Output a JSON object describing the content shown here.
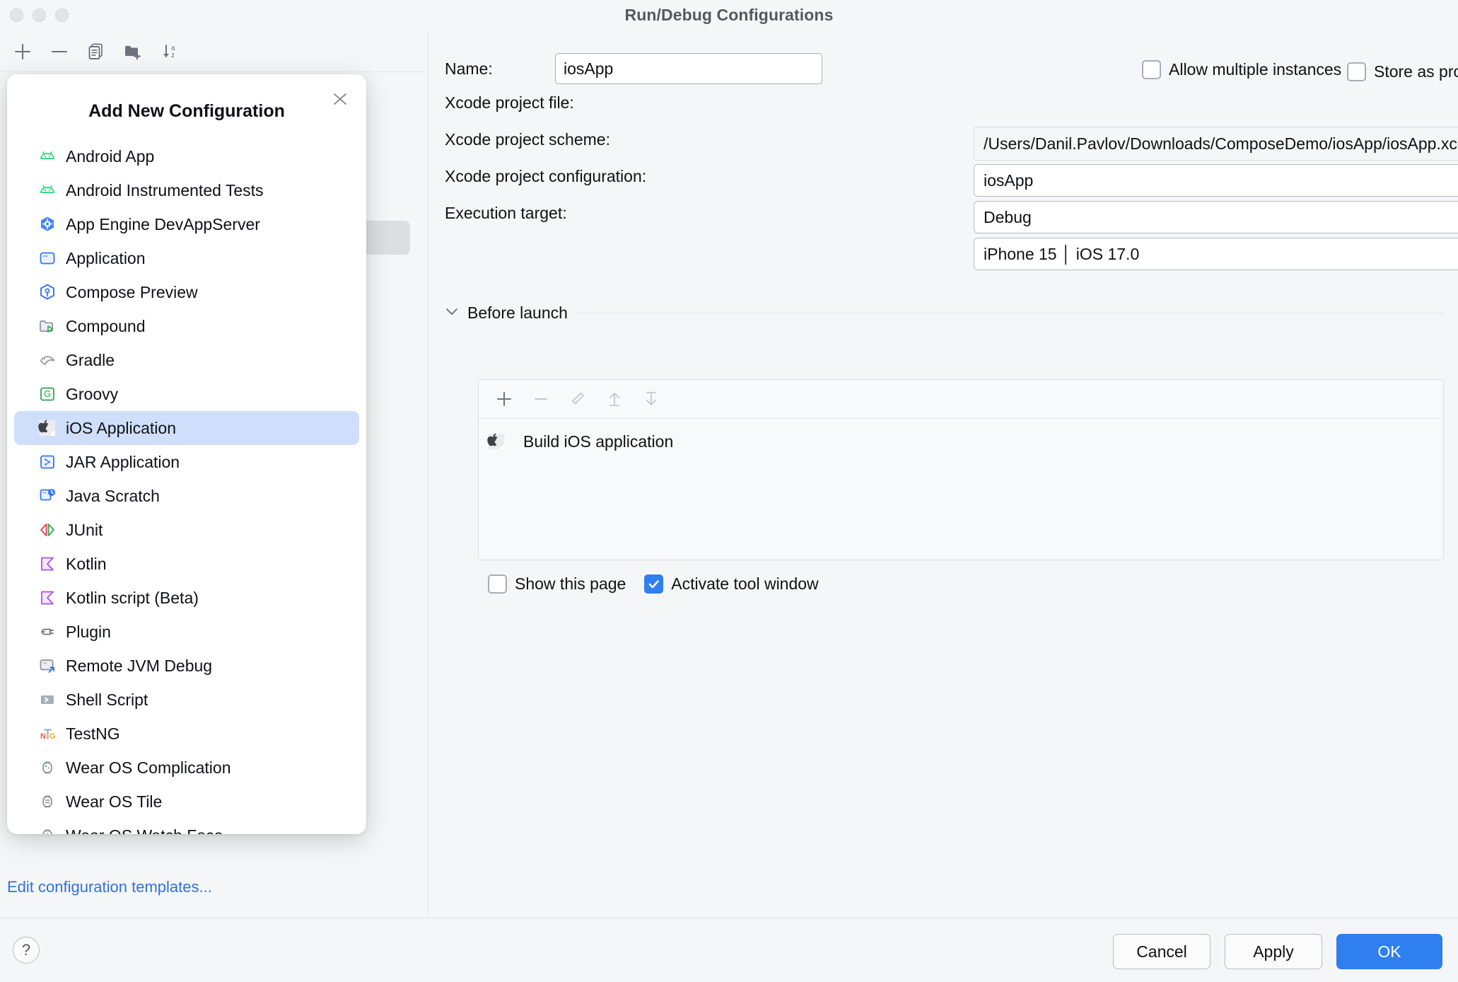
{
  "window": {
    "title": "Run/Debug Configurations",
    "traffic_lights": [
      "close",
      "minimize",
      "zoom"
    ]
  },
  "left_panel": {
    "toolbar": [
      {
        "name": "add-configuration-button",
        "icon": "plus-icon"
      },
      {
        "name": "remove-configuration-button",
        "icon": "minus-icon"
      },
      {
        "name": "copy-configuration-button",
        "icon": "copy-icon"
      },
      {
        "name": "new-folder-button",
        "icon": "new-folder-icon"
      },
      {
        "name": "sort-configurations-button",
        "icon": "sort-az-icon"
      }
    ],
    "edit_templates_link": "Edit configuration templates..."
  },
  "popup": {
    "title": "Add New Configuration",
    "close_icon": "close-icon",
    "items": [
      {
        "label": "Android App",
        "icon": "android-icon"
      },
      {
        "label": "Android Instrumented Tests",
        "icon": "android-icon"
      },
      {
        "label": "App Engine DevAppServer",
        "icon": "app-engine-icon"
      },
      {
        "label": "Application",
        "icon": "application-icon"
      },
      {
        "label": "Compose Preview",
        "icon": "compose-preview-icon"
      },
      {
        "label": "Compound",
        "icon": "compound-icon"
      },
      {
        "label": "Gradle",
        "icon": "gradle-icon"
      },
      {
        "label": "Groovy",
        "icon": "groovy-icon"
      },
      {
        "label": "iOS Application",
        "icon": "apple-icon",
        "selected": true
      },
      {
        "label": "JAR Application",
        "icon": "jar-icon"
      },
      {
        "label": "Java Scratch",
        "icon": "java-scratch-icon"
      },
      {
        "label": "JUnit",
        "icon": "junit-icon"
      },
      {
        "label": "Kotlin",
        "icon": "kotlin-icon"
      },
      {
        "label": "Kotlin script (Beta)",
        "icon": "kotlin-icon"
      },
      {
        "label": "Plugin",
        "icon": "plugin-icon"
      },
      {
        "label": "Remote JVM Debug",
        "icon": "remote-debug-icon"
      },
      {
        "label": "Shell Script",
        "icon": "shell-script-icon"
      },
      {
        "label": "TestNG",
        "icon": "testng-icon"
      },
      {
        "label": "Wear OS Complication",
        "icon": "wear-os-complication-icon"
      },
      {
        "label": "Wear OS Tile",
        "icon": "wear-os-tile-icon"
      },
      {
        "label": "Wear OS Watch Face",
        "icon": "wear-os-watch-face-icon"
      }
    ]
  },
  "form": {
    "name_label": "Name:",
    "name_value": "iosApp",
    "allow_multiple_instances": {
      "label": "Allow multiple instances",
      "checked": false
    },
    "store_as_project_file": {
      "label": "Store as project file",
      "checked": false,
      "gear_icon": "gear-icon"
    },
    "xcode_project_file": {
      "label": "Xcode project file:",
      "value": "/Users/Danil.Pavlov/Downloads/ComposeDemo/iosApp/iosApp.xcodeproj",
      "browse_icon": "folder-icon"
    },
    "xcode_project_scheme": {
      "label": "Xcode project scheme:",
      "value": "iosApp"
    },
    "xcode_project_configuration": {
      "label": "Xcode project configuration:",
      "value": "Debug"
    },
    "execution_target": {
      "label": "Execution target:",
      "value": "iPhone 15 │ iOS 17.0"
    }
  },
  "before_launch": {
    "section_title": "Before launch",
    "collapse_icon": "chevron-down-icon",
    "toolbar": [
      {
        "name": "add-task-button",
        "icon": "plus-icon",
        "enabled": true
      },
      {
        "name": "remove-task-button",
        "icon": "minus-icon",
        "enabled": false
      },
      {
        "name": "edit-task-button",
        "icon": "pencil-icon",
        "enabled": false
      },
      {
        "name": "move-task-up-button",
        "icon": "arrow-up-icon",
        "enabled": false
      },
      {
        "name": "move-task-down-button",
        "icon": "arrow-down-icon",
        "enabled": false
      }
    ],
    "tasks": [
      {
        "label": "Build iOS application",
        "icon": "apple-icon"
      }
    ],
    "show_this_page": {
      "label": "Show this page",
      "checked": false
    },
    "activate_tool_window": {
      "label": "Activate tool window",
      "checked": true
    }
  },
  "footer": {
    "help_label": "?",
    "cancel_label": "Cancel",
    "apply_label": "Apply",
    "ok_label": "OK"
  },
  "colors": {
    "accent": "#2f7ff0",
    "selection": "#cfdffb",
    "link": "#2f72dc",
    "background": "#f5f6f7"
  }
}
